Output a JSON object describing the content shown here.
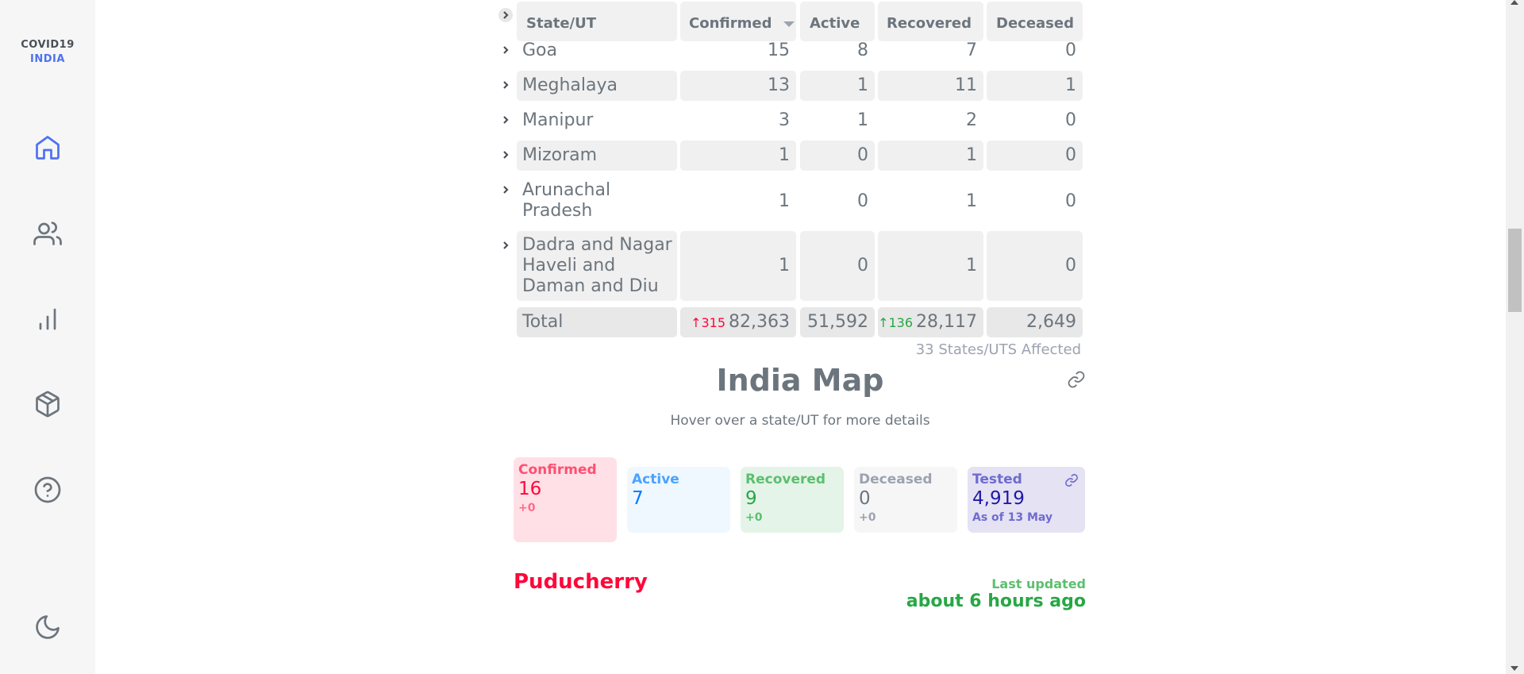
{
  "app": {
    "logo_line1": "COVID19",
    "logo_line2": "INDIA"
  },
  "sidebar": {
    "items": [
      {
        "icon": "home-icon",
        "active": true
      },
      {
        "icon": "users-icon",
        "active": false
      },
      {
        "icon": "bar-chart-icon",
        "active": false
      },
      {
        "icon": "package-icon",
        "active": false
      },
      {
        "icon": "help-circle-icon",
        "active": false
      },
      {
        "icon": "moon-icon",
        "active": false
      }
    ]
  },
  "table": {
    "headers": {
      "state": "State/UT",
      "confirmed": "Confirmed",
      "active": "Active",
      "recovered": "Recovered",
      "deceased": "Deceased"
    },
    "sort_icon": "caret-down-icon",
    "rows": [
      {
        "name": "Goa",
        "confirmed": "15",
        "active": "8",
        "recovered": "7",
        "deceased": "0"
      },
      {
        "name": "Meghalaya",
        "confirmed": "13",
        "active": "1",
        "recovered": "11",
        "deceased": "1"
      },
      {
        "name": "Manipur",
        "confirmed": "3",
        "active": "1",
        "recovered": "2",
        "deceased": "0"
      },
      {
        "name": "Mizoram",
        "confirmed": "1",
        "active": "0",
        "recovered": "1",
        "deceased": "0"
      },
      {
        "name": "Arunachal Pradesh",
        "confirmed": "1",
        "active": "0",
        "recovered": "1",
        "deceased": "0"
      },
      {
        "name": "Dadra and Nagar Haveli and Daman and Diu",
        "confirmed": "1",
        "active": "0",
        "recovered": "1",
        "deceased": "0"
      }
    ],
    "total": {
      "label": "Total",
      "confirmed_delta": "↑315",
      "confirmed": "82,363",
      "active": "51,592",
      "recovered_delta": "↑136",
      "recovered": "28,117",
      "deceased": "2,649"
    },
    "affected_note": "33 States/UTS Affected"
  },
  "map": {
    "title": "India Map",
    "subtitle": "Hover over a state/UT for more details",
    "stats": {
      "confirmed": {
        "label": "Confirmed",
        "value": "16",
        "delta": "+0"
      },
      "active": {
        "label": "Active",
        "value": "7"
      },
      "recovered": {
        "label": "Recovered",
        "value": "9",
        "delta": "+0"
      },
      "deceased": {
        "label": "Deceased",
        "value": "0",
        "delta": "+0"
      },
      "tested": {
        "label": "Tested",
        "value": "4,919",
        "note": "As of 13 May"
      }
    },
    "region": "Puducherry",
    "last_updated_label": "Last updated",
    "last_updated_value": "about 6 hours ago"
  },
  "colors": {
    "confirmed": "#ff073a",
    "active": "#007bff",
    "recovered": "#28a745",
    "deceased": "#6c757d",
    "tested": "#201aa2",
    "accent": "#4d71f2"
  }
}
